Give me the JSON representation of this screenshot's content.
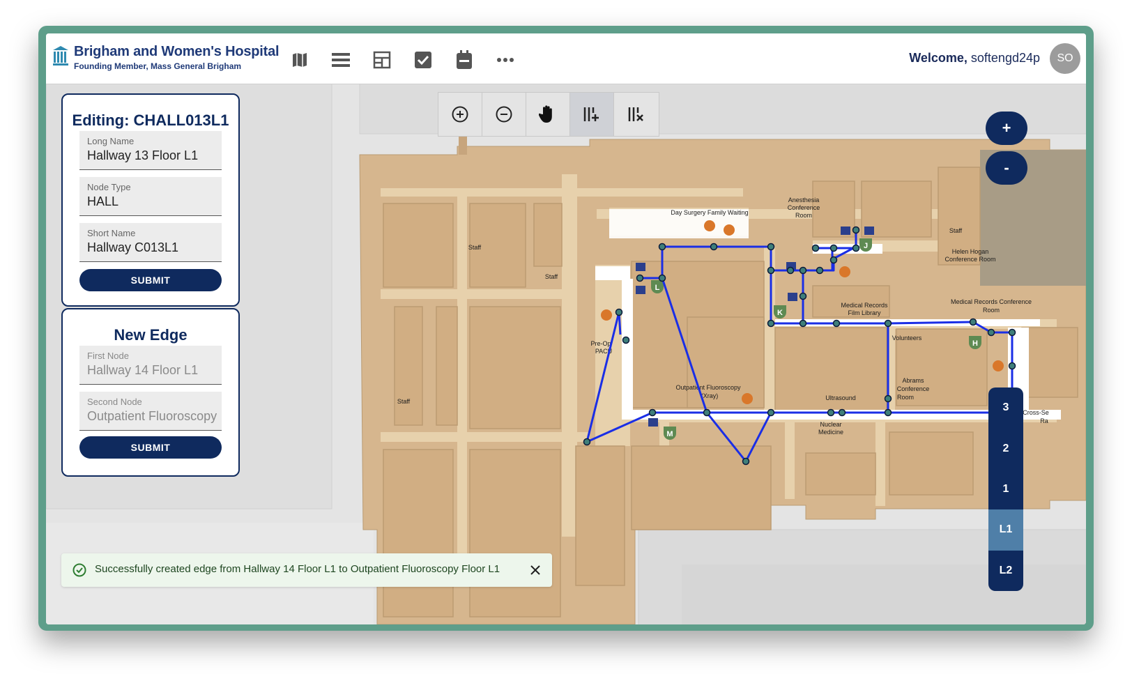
{
  "header": {
    "brand_name": "Brigham and Women's Hospital",
    "brand_subtitle": "Founding Member, Mass General Brigham",
    "nav_icons": [
      "map-icon",
      "list-icon",
      "layout-icon",
      "checkbox-icon",
      "calendar-icon",
      "more-icon"
    ],
    "welcome_prefix": "Welcome,",
    "username": "softengd24p",
    "avatar_initials": "SO"
  },
  "edit_panel": {
    "title": "Editing: CHALL013L1",
    "fields": [
      {
        "label": "Long Name",
        "value": "Hallway 13 Floor L1"
      },
      {
        "label": "Node Type",
        "value": "HALL"
      },
      {
        "label": "Short Name",
        "value": "Hallway C013L1"
      }
    ],
    "submit_label": "SUBMIT"
  },
  "edge_panel": {
    "title": "New Edge",
    "fields": [
      {
        "label": "First Node",
        "value": "Hallway 14 Floor L1"
      },
      {
        "label": "Second Node",
        "value": "Outpatient Fluoroscopy"
      }
    ],
    "submit_label": "SUBMIT"
  },
  "map_toolbar": {
    "tools": [
      "zoom-in-icon",
      "zoom-out-icon",
      "pan-hand-icon",
      "add-edge-icon",
      "remove-edge-icon"
    ],
    "active_tool": "add-edge-icon"
  },
  "zoom": {
    "in_label": "+",
    "out_label": "-"
  },
  "floors": {
    "options": [
      "3",
      "2",
      "1",
      "L1",
      "L2"
    ],
    "selected": "L1"
  },
  "map_labels": {
    "day_surgery": "Day Surgery Family Waiting",
    "anesthesia_1": "Anesthesia",
    "anesthesia_2": "Conference",
    "anesthesia_3": "Room",
    "staff": "Staff",
    "helen_hogan_1": "Helen Hogan",
    "helen_hogan_2": "Conference Room",
    "medical_records_film_1": "Medical Records",
    "medical_records_film_2": "Film Library",
    "medical_records_conf_1": "Medical Records Conference",
    "medical_records_conf_2": "Room",
    "pre_op_1": "Pre-Op",
    "pre_op_2": "PACU",
    "volunteers": "Volunteers",
    "abrams_1": "Abrams",
    "abrams_2": "Conference",
    "abrams_3": "Room",
    "outpatient_fluoro_1": "Outpatient Fluoroscopy",
    "outpatient_fluoro_2": "(Xray)",
    "ultrasound": "Ultrasound",
    "nuclear_1": "Nuclear",
    "nuclear_2": "Medicine",
    "cross_sec": "Cross-Se",
    "cross_sec_2": "Ra",
    "elevator_badges": [
      "J",
      "L",
      "K",
      "H",
      "M"
    ]
  },
  "colors": {
    "brand": "#0f2a5e",
    "path": "#1a2ee6",
    "node": "#3f7f7a",
    "building": "#d6b68e",
    "hallway": "#e7d1ac",
    "elevator_badge": "#5e8a52"
  },
  "toast": {
    "message": "Successfully created edge from Hallway 14 Floor L1 to Outpatient Fluoroscopy Floor L1"
  }
}
